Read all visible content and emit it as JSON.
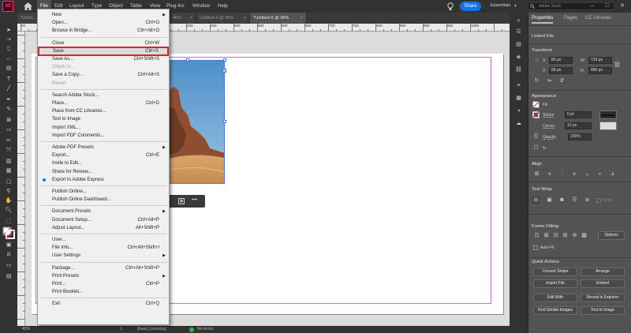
{
  "app": {
    "logo": "Id",
    "workspace": "Essentials",
    "share_label": "Share",
    "stock_placeholder": "Adobe Stock"
  },
  "menubar": [
    "File",
    "Edit",
    "Layout",
    "Type",
    "Object",
    "Table",
    "View",
    "Plug-Ins",
    "Window",
    "Help"
  ],
  "tabs": [
    {
      "label": "*Untitl...",
      "active": false
    },
    {
      "label": "45%",
      "active": false
    },
    {
      "label": "Untitled-4 @ 45%",
      "active": false
    },
    {
      "label": "*Untitled-5 @ 45%",
      "active": true
    }
  ],
  "file_menu": [
    {
      "label": "New",
      "shortcut": "",
      "submenu": true
    },
    {
      "label": "Open...",
      "shortcut": "Ctrl+O"
    },
    {
      "label": "Browse in Bridge...",
      "shortcut": "Ctrl+Alt+O"
    },
    {
      "sep": true
    },
    {
      "label": "Close",
      "shortcut": "Ctrl+W"
    },
    {
      "label": "Save",
      "shortcut": "Ctrl+S",
      "highlight": true
    },
    {
      "label": "Save As...",
      "shortcut": "Ctrl+Shift+S"
    },
    {
      "label": "Check In...",
      "shortcut": "",
      "disabled": true
    },
    {
      "label": "Save a Copy...",
      "shortcut": "Ctrl+Alt+S"
    },
    {
      "label": "Revert",
      "shortcut": "",
      "disabled": true
    },
    {
      "sep": true
    },
    {
      "label": "Search Adobe Stock...",
      "shortcut": ""
    },
    {
      "label": "Place...",
      "shortcut": "Ctrl+D"
    },
    {
      "label": "Place from CC Libraries...",
      "shortcut": ""
    },
    {
      "label": "Text to Image",
      "shortcut": ""
    },
    {
      "label": "Import XML...",
      "shortcut": ""
    },
    {
      "label": "Import PDF Comments...",
      "shortcut": ""
    },
    {
      "sep": true
    },
    {
      "label": "Adobe PDF Presets",
      "shortcut": "",
      "submenu": true
    },
    {
      "label": "Export...",
      "shortcut": "Ctrl+E"
    },
    {
      "label": "Invite to Edit...",
      "shortcut": ""
    },
    {
      "label": "Share for Review...",
      "shortcut": ""
    },
    {
      "label": "Export to Adobe Express",
      "shortcut": "",
      "bullet": true
    },
    {
      "sep": true
    },
    {
      "label": "Publish Online...",
      "shortcut": ""
    },
    {
      "label": "Publish Online Dashboard...",
      "shortcut": ""
    },
    {
      "sep": true
    },
    {
      "label": "Document Presets",
      "shortcut": "",
      "submenu": true
    },
    {
      "label": "Document Setup...",
      "shortcut": "Ctrl+Alt+P"
    },
    {
      "label": "Adjust Layout...",
      "shortcut": "Alt+Shift+P"
    },
    {
      "sep": true
    },
    {
      "label": "User...",
      "shortcut": ""
    },
    {
      "label": "File Info...",
      "shortcut": "Ctrl+Alt+Shift+I"
    },
    {
      "label": "User Settings",
      "shortcut": "",
      "submenu": true
    },
    {
      "sep": true
    },
    {
      "label": "Package...",
      "shortcut": "Ctrl+Alt+Shift+P"
    },
    {
      "label": "Print Presets",
      "shortcut": "",
      "submenu": true
    },
    {
      "label": "Print...",
      "shortcut": "Ctrl+P"
    },
    {
      "label": "Print Booklet...",
      "shortcut": ""
    },
    {
      "sep": true
    },
    {
      "label": "Exit",
      "shortcut": "Ctrl+Q"
    }
  ],
  "ruler_numbers": [
    "50",
    "100",
    "150",
    "200",
    "250",
    "300",
    "350",
    "400",
    "450",
    "500",
    "550",
    "600",
    "650",
    "700",
    "750",
    "800",
    "850",
    "900",
    "950",
    "1000"
  ],
  "status": {
    "zoom": "45%",
    "page": "1",
    "style": "[Basic] (working)",
    "preflight": "No errors"
  },
  "panel": {
    "tabs": [
      "Properties",
      "Pages",
      "CC Libraries"
    ],
    "object_type": "Linked File",
    "transform_title": "Transform",
    "x_label": "X:",
    "x": "80 px",
    "y_label": "Y:",
    "y": "58 px",
    "w_label": "W:",
    "w": "719 px",
    "h_label": "H:",
    "h": "490 px",
    "appearance_title": "Appearance",
    "fill": "Fill",
    "stroke": "Stroke",
    "stroke_weight": "0 pt",
    "corner": "Corner",
    "corner_size": "12 px",
    "opacity": "Opacity",
    "opacity_value": "100%",
    "fx": "fx.",
    "align_title": "Align",
    "text_wrap_title": "Text Wrap",
    "invert": "Invert",
    "frame_fitting_title": "Frame Fitting",
    "options": "Options",
    "auto_fit": "Auto-Fit",
    "quick_actions_title": "Quick Actions",
    "quick_actions": [
      "Convert Shape",
      "Arrange",
      "Import File",
      "Embed",
      "Edit With",
      "Reveal in Explorer",
      "Find Similar Images",
      "Text to Image"
    ]
  }
}
